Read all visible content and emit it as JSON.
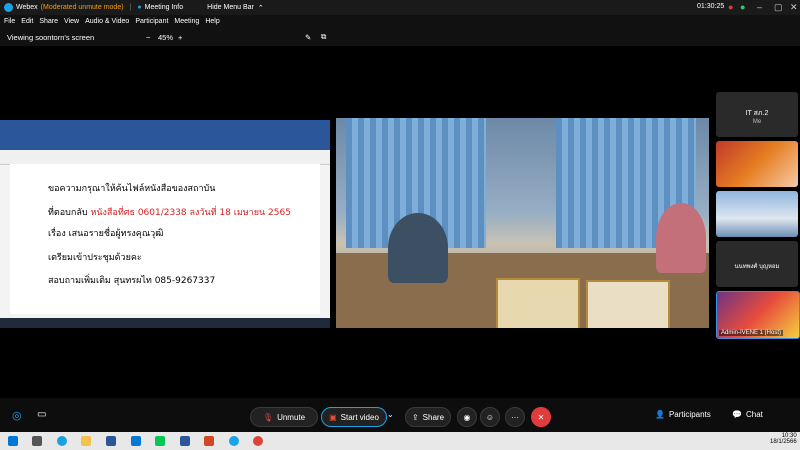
{
  "titlebar": {
    "app": "Webex",
    "mode": "(Moderated unmute mode)",
    "meeting_info": "Meeting Info",
    "hide_menu": "Hide Menu Bar",
    "timer": "01:30:25"
  },
  "menu": [
    "File",
    "Edit",
    "Share",
    "View",
    "Audio & Video",
    "Participant",
    "Meeting",
    "Help"
  ],
  "view": {
    "title": "Viewing soontorn's screen",
    "zoom": "45%",
    "minus": "−",
    "plus": "+"
  },
  "doc": {
    "line1": "ขอความกรุณาให้ค้นไฟล์หนังสือของสถาบัน",
    "line2a": "ที่ตอบกลับ ",
    "line2b": "หนังสือที่ศธ  0601/2338 ลงวันที่ 18 เมษายน 2565",
    "line3": "เรื่อง  เสนอรายชื่อผู้ทรงคุณวุฒิ",
    "line4": "เตรียมเข้าประชุมด้วยคะ",
    "line5": "สอบถามเพิ่มเติม สุนทรผไท   085-9267337"
  },
  "panels": {
    "p1": "IT สภ.2",
    "p1_sub": "Me",
    "p4": "นนทพงศ์ บุญหอม",
    "p5": "Admin-IVENE 1 (Host)"
  },
  "controls": {
    "unmute": "Unmute",
    "start_video": "Start video",
    "share": "Share",
    "participants": "Participants",
    "chat": "Chat"
  },
  "clock": {
    "time": "10:30",
    "date": "18/1/2566"
  }
}
